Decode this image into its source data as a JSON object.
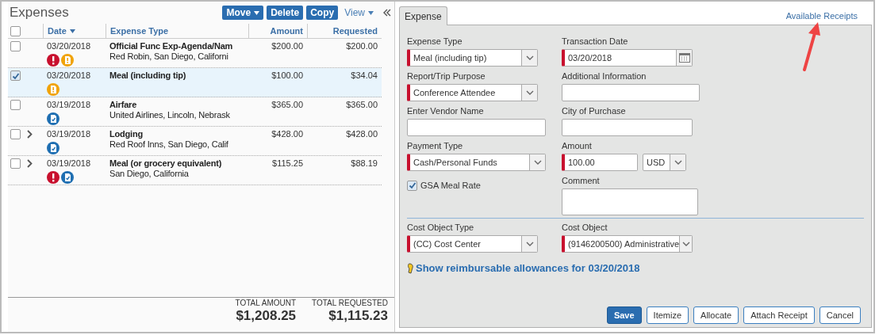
{
  "expenses": {
    "title": "Expenses",
    "toolbar": [
      {
        "label": "Move",
        "kind": "dropdown"
      },
      {
        "label": "Delete",
        "kind": "button"
      },
      {
        "label": "Copy",
        "kind": "button"
      },
      {
        "label": "View",
        "kind": "menu"
      }
    ],
    "header_checkbox": {
      "checked": false
    },
    "columns": [
      {
        "label": "Date",
        "sorted": true
      },
      {
        "label": "Expense Type",
        "sorted": false
      },
      {
        "label": "Amount",
        "sorted": false
      },
      {
        "label": "Requested",
        "sorted": false
      }
    ],
    "rows": [
      {
        "selected": false,
        "expandable": false,
        "date": "03/20/2018",
        "type": "Official Func Exp-Agenda/Nam",
        "detail": "Red Robin, San Diego, Californi",
        "amount": "$200.00",
        "requested": "$200.00",
        "icons": [
          {
            "kind": "exception"
          },
          {
            "kind": "receipt-warning"
          }
        ]
      },
      {
        "selected": true,
        "expandable": false,
        "date": "03/20/2018",
        "type": "Meal (including tip)",
        "amount": "$100.00",
        "requested": "$34.04",
        "icons": [
          {
            "kind": "receipt-warning"
          }
        ]
      },
      {
        "selected": false,
        "expandable": false,
        "date": "03/19/2018",
        "type": "Airfare",
        "detail": "United Airlines, Lincoln, Nebrask",
        "amount": "$365.00",
        "requested": "$365.00",
        "icons": [
          {
            "kind": "receipt-ok"
          }
        ]
      },
      {
        "selected": false,
        "expandable": true,
        "date": "03/19/2018",
        "type": "Lodging",
        "detail": "Red Roof Inns, San Diego, Calif",
        "amount": "$428.00",
        "requested": "$428.00",
        "icons": [
          {
            "kind": "receipt-ok"
          }
        ]
      },
      {
        "selected": false,
        "expandable": true,
        "date": "03/19/2018",
        "type": "Meal (or grocery equivalent)",
        "detail": "San Diego, California",
        "amount": "$115.25",
        "requested": "$88.19",
        "icons": [
          {
            "kind": "exception"
          },
          {
            "kind": "receipt-ok"
          }
        ]
      }
    ],
    "totals": [
      {
        "label": "TOTAL AMOUNT",
        "value": "$1,208.25"
      },
      {
        "label": "TOTAL REQUESTED",
        "value": "$1,115.23"
      }
    ]
  },
  "detail": {
    "tabs": [
      {
        "label": "Expense",
        "selected": true
      }
    ],
    "available_receipts": "Available Receipts",
    "fields": [
      {
        "label": "Expense Type",
        "kind": "select",
        "value": "Meal (including tip)",
        "required": true
      },
      {
        "label": "Transaction Date",
        "kind": "date",
        "value": "03/20/2018",
        "required": true
      },
      {
        "label": "Report/Trip Purpose",
        "kind": "select",
        "value": "Conference Attendee",
        "required": true
      },
      {
        "label": "Additional Information",
        "kind": "text",
        "required": false
      },
      {
        "label": "Enter Vendor Name",
        "kind": "text",
        "required": false
      },
      {
        "label": "City of Purchase",
        "kind": "text",
        "required": false
      },
      {
        "label": "Payment Type",
        "kind": "select",
        "value": "Cash/Personal Funds",
        "required": true
      },
      {
        "label": "Amount",
        "kind": "amount",
        "value": "100.00",
        "currency": "USD",
        "required": true
      },
      {
        "label": "GSA Meal Rate",
        "kind": "checkbox",
        "checked": true
      },
      {
        "label": "Comment",
        "kind": "textarea",
        "required": false
      }
    ],
    "cost_fields": [
      {
        "label": "Cost Object Type",
        "kind": "select",
        "value": "(CC) Cost Center",
        "required": true
      },
      {
        "label": "Cost Object",
        "kind": "select",
        "value": "(9146200500) Administrative",
        "required": true
      }
    ],
    "allowances_link": "Show reimbursable allowances for 03/20/2018",
    "buttons": [
      {
        "label": "Save",
        "kind": "primary"
      },
      {
        "label": "Itemize",
        "kind": "secondary"
      },
      {
        "label": "Allocate",
        "kind": "secondary"
      },
      {
        "label": "Attach Receipt",
        "kind": "secondary"
      },
      {
        "label": "Cancel",
        "kind": "secondary"
      }
    ]
  }
}
